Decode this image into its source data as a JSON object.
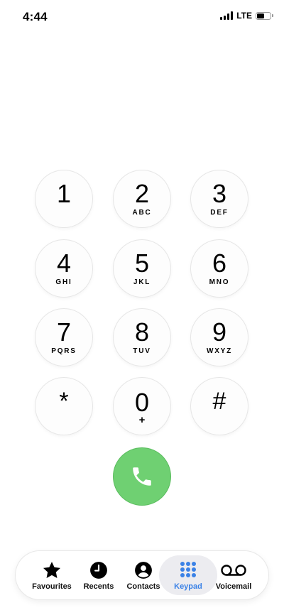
{
  "status": {
    "time": "4:44",
    "network": "LTE",
    "battery_level_percent": 55
  },
  "keypad": {
    "keys": [
      {
        "digit": "1",
        "letters": ""
      },
      {
        "digit": "2",
        "letters": "ABC"
      },
      {
        "digit": "3",
        "letters": "DEF"
      },
      {
        "digit": "4",
        "letters": "GHI"
      },
      {
        "digit": "5",
        "letters": "JKL"
      },
      {
        "digit": "6",
        "letters": "MNO"
      },
      {
        "digit": "7",
        "letters": "PQRS"
      },
      {
        "digit": "8",
        "letters": "TUV"
      },
      {
        "digit": "9",
        "letters": "WXYZ"
      },
      {
        "digit": "*",
        "letters": ""
      },
      {
        "digit": "0",
        "letters": "+"
      },
      {
        "digit": "#",
        "letters": ""
      }
    ]
  },
  "call_button": {
    "icon": "phone-icon",
    "color": "#6fd072"
  },
  "tabs": [
    {
      "label": "Favourites",
      "icon": "star-icon",
      "active": false
    },
    {
      "label": "Recents",
      "icon": "clock-icon",
      "active": false
    },
    {
      "label": "Contacts",
      "icon": "person-circle-icon",
      "active": false
    },
    {
      "label": "Keypad",
      "icon": "keypad-grid-icon",
      "active": true
    },
    {
      "label": "Voicemail",
      "icon": "voicemail-icon",
      "active": false
    }
  ],
  "colors": {
    "accent": "#3b82e6",
    "call_green": "#6fd072",
    "tab_selected_bg": "#ececf0"
  }
}
